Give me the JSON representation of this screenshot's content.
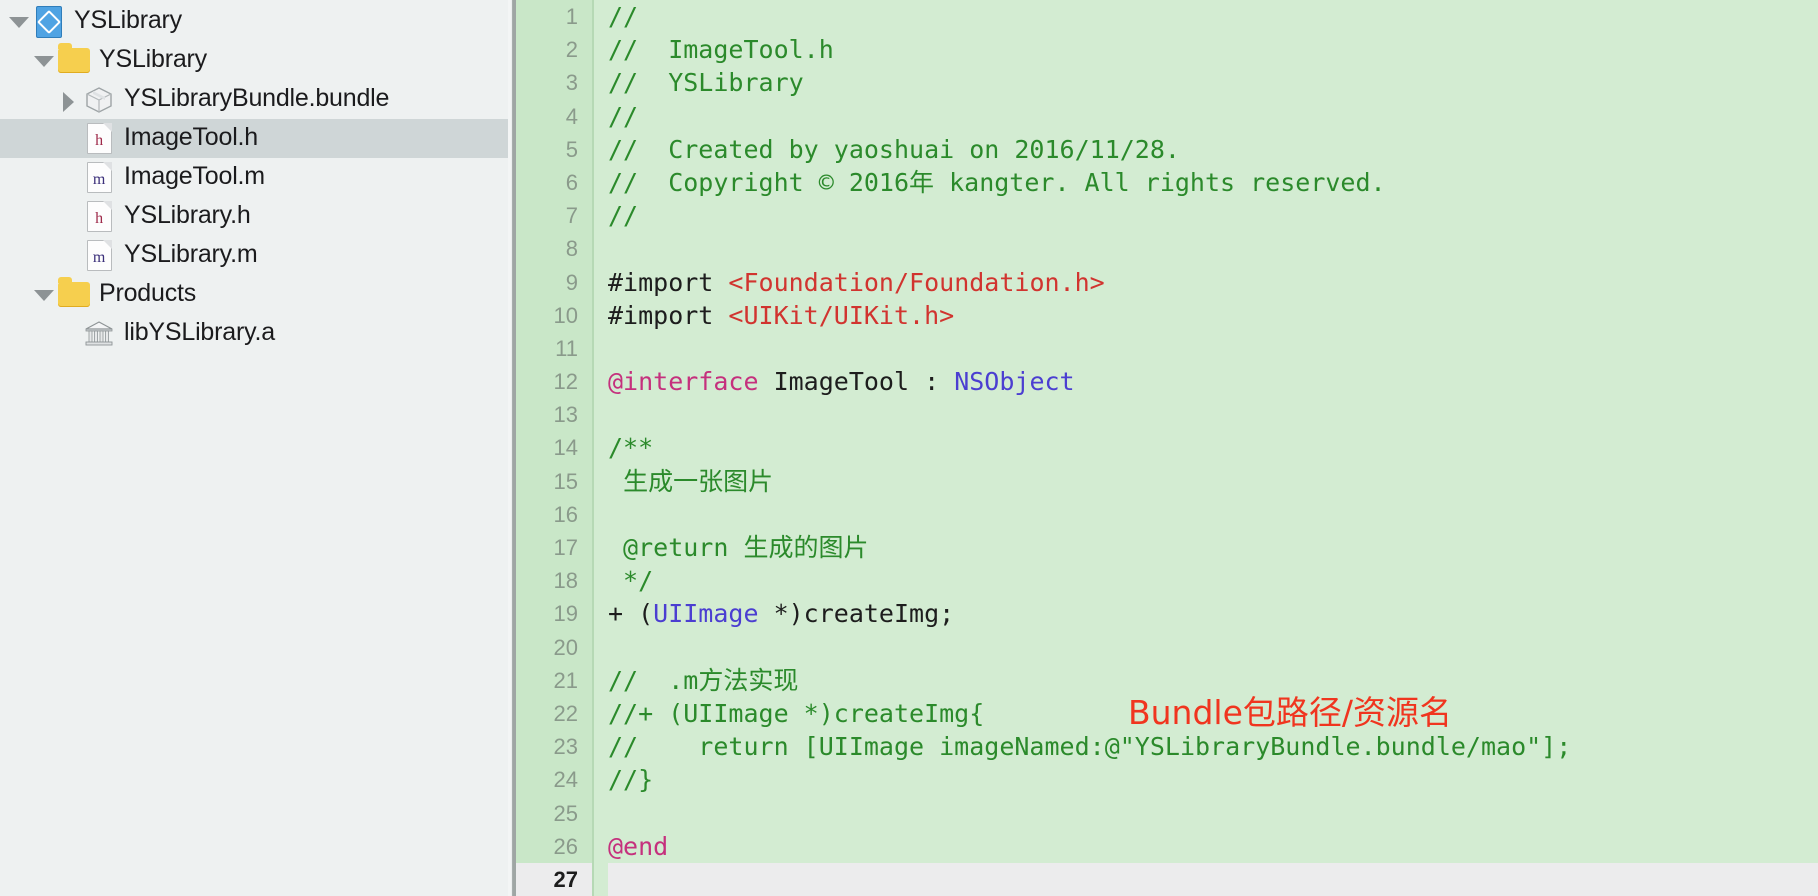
{
  "navigator": {
    "name": "project-navigator",
    "items": [
      {
        "label": "YSLibrary",
        "icon": "xcode-project-icon",
        "indent": 0,
        "twisty": "open",
        "selected": false
      },
      {
        "label": "YSLibrary",
        "icon": "folder-icon",
        "indent": 1,
        "twisty": "open",
        "selected": false
      },
      {
        "label": "YSLibraryBundle.bundle",
        "icon": "bundle-icon",
        "indent": 2,
        "twisty": "closed",
        "selected": false
      },
      {
        "label": "ImageTool.h",
        "icon": "header-file-icon",
        "ext": "h",
        "indent": 2,
        "twisty": "none",
        "selected": true
      },
      {
        "label": "ImageTool.m",
        "icon": "source-file-icon",
        "ext": "m",
        "indent": 2,
        "twisty": "none",
        "selected": false
      },
      {
        "label": "YSLibrary.h",
        "icon": "header-file-icon",
        "ext": "h",
        "indent": 2,
        "twisty": "none",
        "selected": false
      },
      {
        "label": "YSLibrary.m",
        "icon": "source-file-icon",
        "ext": "m",
        "indent": 2,
        "twisty": "none",
        "selected": false
      },
      {
        "label": "Products",
        "icon": "folder-icon",
        "indent": 1,
        "twisty": "open",
        "selected": false
      },
      {
        "label": "libYSLibrary.a",
        "icon": "static-library-icon",
        "indent": 2,
        "twisty": "none",
        "selected": false
      }
    ]
  },
  "editor": {
    "name": "source-code-editor",
    "filename": "ImageTool.h",
    "current_line": 27,
    "total_lines": 27,
    "line_numbers": [
      1,
      2,
      3,
      4,
      5,
      6,
      7,
      8,
      9,
      10,
      11,
      12,
      13,
      14,
      15,
      16,
      17,
      18,
      19,
      20,
      21,
      22,
      23,
      24,
      25,
      26,
      27
    ],
    "colors": {
      "background": "#d3ecd2",
      "gutter_background": "#c9e7c8",
      "current_line_background": "#ececed",
      "comment": "#2b8a2b",
      "string": "#d1342f",
      "keyword": "#c5307d",
      "type": "#4b3ed1",
      "plain": "#1d1d1d",
      "annotation": "#f0351f"
    },
    "lines": [
      {
        "n": 1,
        "tokens": [
          {
            "t": "comment",
            "s": "//"
          }
        ]
      },
      {
        "n": 2,
        "tokens": [
          {
            "t": "comment",
            "s": "//  ImageTool.h"
          }
        ]
      },
      {
        "n": 3,
        "tokens": [
          {
            "t": "comment",
            "s": "//  YSLibrary"
          }
        ]
      },
      {
        "n": 4,
        "tokens": [
          {
            "t": "comment",
            "s": "//"
          }
        ]
      },
      {
        "n": 5,
        "tokens": [
          {
            "t": "comment",
            "s": "//  Created by yaoshuai on 2016/11/28."
          }
        ]
      },
      {
        "n": 6,
        "tokens": [
          {
            "t": "comment",
            "s": "//  Copyright © 2016"
          },
          {
            "t": "cjk",
            "s": "年"
          },
          {
            "t": "comment",
            "s": " kangter. All rights reserved."
          }
        ]
      },
      {
        "n": 7,
        "tokens": [
          {
            "t": "comment",
            "s": "//"
          }
        ]
      },
      {
        "n": 8,
        "tokens": []
      },
      {
        "n": 9,
        "tokens": [
          {
            "t": "pre",
            "s": "#import "
          },
          {
            "t": "str",
            "s": "<Foundation/Foundation.h>"
          }
        ]
      },
      {
        "n": 10,
        "tokens": [
          {
            "t": "pre",
            "s": "#import "
          },
          {
            "t": "str",
            "s": "<UIKit/UIKit.h>"
          }
        ]
      },
      {
        "n": 11,
        "tokens": []
      },
      {
        "n": 12,
        "tokens": [
          {
            "t": "kw",
            "s": "@interface"
          },
          {
            "t": "plain",
            "s": " ImageTool : "
          },
          {
            "t": "type",
            "s": "NSObject"
          }
        ]
      },
      {
        "n": 13,
        "tokens": []
      },
      {
        "n": 14,
        "tokens": [
          {
            "t": "comment",
            "s": "/**"
          }
        ]
      },
      {
        "n": 15,
        "tokens": [
          {
            "t": "comment",
            "s": " "
          },
          {
            "t": "cjk",
            "s": "生成一张图片"
          }
        ]
      },
      {
        "n": 16,
        "tokens": []
      },
      {
        "n": 17,
        "tokens": [
          {
            "t": "comment",
            "s": " @return "
          },
          {
            "t": "cjk",
            "s": "生成的图片"
          }
        ]
      },
      {
        "n": 18,
        "tokens": [
          {
            "t": "comment",
            "s": " */"
          }
        ]
      },
      {
        "n": 19,
        "tokens": [
          {
            "t": "plain",
            "s": "+ ("
          },
          {
            "t": "type",
            "s": "UIImage"
          },
          {
            "t": "plain",
            "s": " *)createImg;"
          }
        ]
      },
      {
        "n": 20,
        "tokens": []
      },
      {
        "n": 21,
        "tokens": [
          {
            "t": "comment",
            "s": "//  .m"
          },
          {
            "t": "cjk",
            "s": "方法实现"
          }
        ]
      },
      {
        "n": 22,
        "tokens": [
          {
            "t": "comment",
            "s": "//+ (UIImage *)createImg{"
          }
        ]
      },
      {
        "n": 23,
        "tokens": [
          {
            "t": "comment",
            "s": "//    return [UIImage imageNamed:@\"YSLibraryBundle.bundle/mao\"];"
          }
        ]
      },
      {
        "n": 24,
        "tokens": [
          {
            "t": "comment",
            "s": "//}"
          }
        ]
      },
      {
        "n": 25,
        "tokens": []
      },
      {
        "n": 26,
        "tokens": [
          {
            "t": "kw",
            "s": "@end"
          }
        ]
      },
      {
        "n": 27,
        "tokens": []
      }
    ]
  },
  "annotation": {
    "name": "bundle-path-annotation",
    "text": "Bundle包路径/资源名"
  }
}
